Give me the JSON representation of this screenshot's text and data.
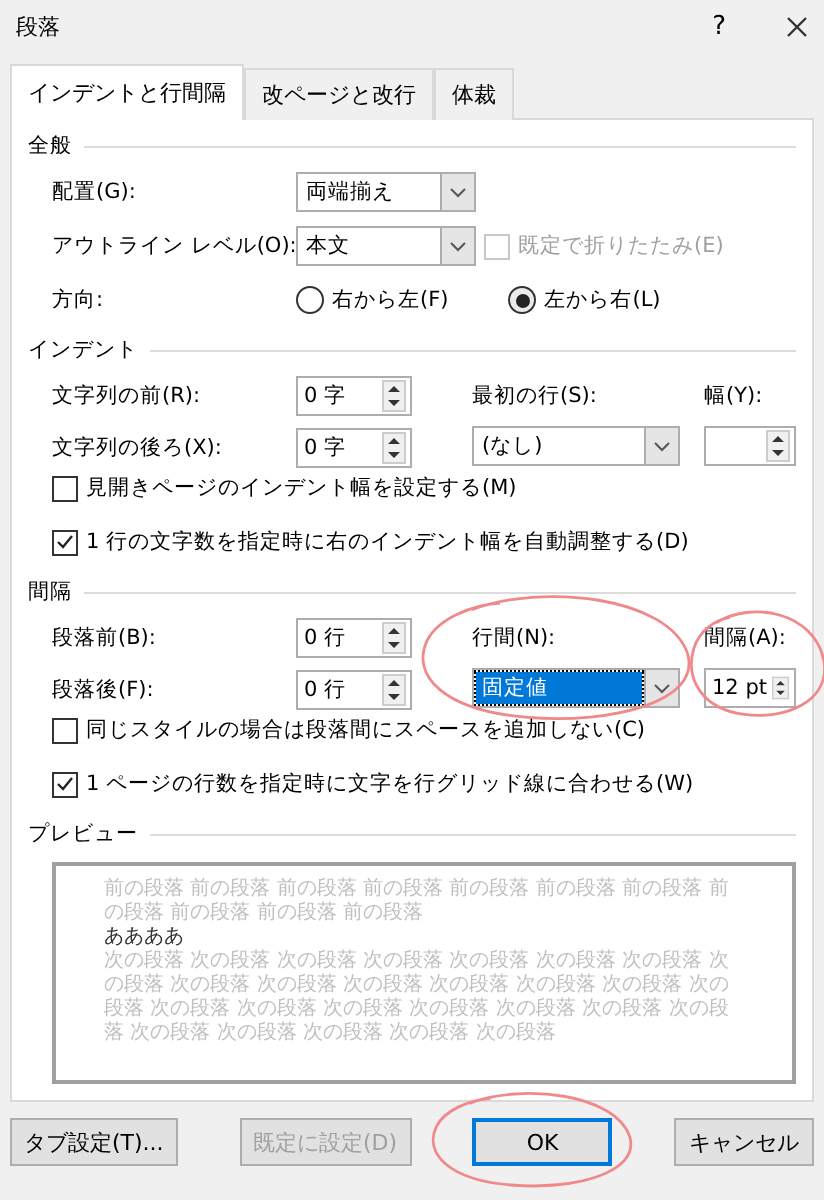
{
  "window": {
    "title": "段落",
    "help": "?"
  },
  "tabs": [
    {
      "label": "インデントと行間隔",
      "selected": true
    },
    {
      "label": "改ページと改行",
      "selected": false
    },
    {
      "label": "体裁",
      "selected": false
    }
  ],
  "general": {
    "heading": "全般",
    "alignment": {
      "label": "配置(G):",
      "value": "両端揃え"
    },
    "outline": {
      "label": "アウトライン レベル(O):",
      "value": "本文"
    },
    "collapse": {
      "label": "既定で折りたたみ(E)",
      "checked": false,
      "disabled": true
    },
    "direction": {
      "label": "方向:",
      "options": [
        {
          "label": "右から左(F)",
          "selected": false
        },
        {
          "label": "左から右(L)",
          "selected": true
        }
      ]
    }
  },
  "indent": {
    "heading": "インデント",
    "before": {
      "label": "文字列の前(R):",
      "value": "0 字"
    },
    "after": {
      "label": "文字列の後ろ(X):",
      "value": "0 字"
    },
    "first_line": {
      "label": "最初の行(S):",
      "value": "(なし)"
    },
    "width": {
      "label": "幅(Y):"
    },
    "mirror": {
      "label": "見開きページのインデント幅を設定する(M)",
      "checked": false
    },
    "auto_adjust": {
      "label": "1 行の文字数を指定時に右のインデント幅を自動調整する(D)",
      "checked": true
    }
  },
  "spacing": {
    "heading": "間隔",
    "before": {
      "label": "段落前(B):",
      "value": "0 行"
    },
    "after": {
      "label": "段落後(F):",
      "value": "0 行"
    },
    "line_spacing": {
      "label": "行間(N):",
      "value": "固定値",
      "focused": true
    },
    "at": {
      "label": "間隔(A):",
      "value": "12 pt"
    },
    "no_space": {
      "label": "同じスタイルの場合は段落間にスペースを追加しない(C)",
      "checked": false
    },
    "grid": {
      "label": "1 ページの行数を指定時に文字を行グリッド線に合わせる(W)",
      "checked": true
    }
  },
  "preview": {
    "heading": "プレビュー",
    "previous": "前の段落 前の段落 前の段落 前の段落 前の段落 前の段落 前の段落 前の段落 前の段落 前の段落 前の段落",
    "current": "ああああ",
    "next": "次の段落 次の段落 次の段落 次の段落 次の段落 次の段落 次の段落 次の段落 次の段落 次の段落 次の段落 次の段落 次の段落 次の段落 次の段落 次の段落 次の段落 次の段落 次の段落 次の段落 次の段落 次の段落 次の段落 次の段落 次の段落 次の段落 次の段落"
  },
  "buttons": [
    {
      "label": "タブ設定(T)...",
      "disabled": false,
      "default": false
    },
    {
      "label": "既定に設定(D)",
      "disabled": true,
      "default": false
    },
    {
      "label": "OK",
      "disabled": false,
      "default": true
    },
    {
      "label": "キャンセル",
      "disabled": false,
      "default": false
    }
  ]
}
